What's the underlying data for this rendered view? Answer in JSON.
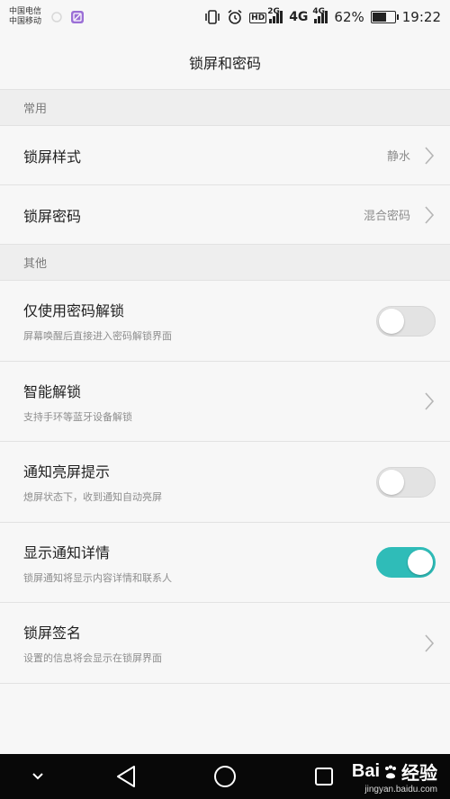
{
  "status_bar": {
    "carrier_1": "中国电信",
    "carrier_2": "中国移动",
    "hd_label": "HD",
    "net_label_1": "2G",
    "net_label_2": "4G",
    "net_label_3": "4G",
    "battery_percent": "62%",
    "battery_level": 0.62,
    "time": "19:22"
  },
  "header": {
    "title": "锁屏和密码"
  },
  "sections": {
    "common": {
      "label": "常用"
    },
    "other": {
      "label": "其他"
    }
  },
  "rows": {
    "lock_style": {
      "title": "锁屏样式",
      "value": "静水"
    },
    "lock_password": {
      "title": "锁屏密码",
      "value": "混合密码"
    },
    "password_only": {
      "title": "仅使用密码解锁",
      "subtitle": "屏幕唤醒后直接进入密码解锁界面",
      "enabled": false
    },
    "smart_unlock": {
      "title": "智能解锁",
      "subtitle": "支持手环等蓝牙设备解锁"
    },
    "notify_wake": {
      "title": "通知亮屏提示",
      "subtitle": "熄屏状态下，收到通知自动亮屏",
      "enabled": false
    },
    "notify_details": {
      "title": "显示通知详情",
      "subtitle": "锁屏通知将显示内容详情和联系人",
      "enabled": true
    },
    "lock_signature": {
      "title": "锁屏签名",
      "subtitle": "设置的信息将会显示在锁屏界面"
    }
  },
  "colors": {
    "toggle_on": "#2fbcb8",
    "toggle_off": "#e3e3e3",
    "background": "#f7f7f7",
    "section": "#eeeeee"
  },
  "watermark": {
    "brand_left": "Bai",
    "brand_right": "经验",
    "url": "jingyan.baidu.com"
  },
  "nav": {
    "icons": [
      "chevron-down-icon",
      "back-triangle-icon",
      "home-circle-icon",
      "recents-square-icon"
    ]
  }
}
